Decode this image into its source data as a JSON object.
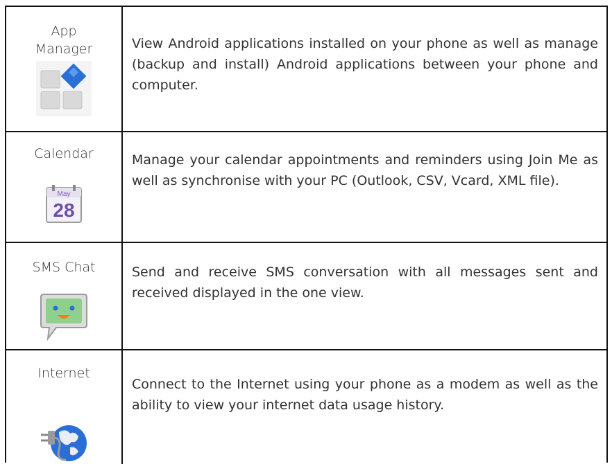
{
  "rows": [
    {
      "name": "App\nManager",
      "icon": "app-manager-icon",
      "description": "View Android applications installed on your phone as well as manage (backup and install) Android applications between your phone and computer."
    },
    {
      "name": "Calendar",
      "icon": "calendar-icon",
      "icon_month": "May",
      "icon_day": "28",
      "description": "Manage your calendar appointments and reminders using Join Me as well as synchronise with your PC (Outlook, CSV, Vcard, XML file)."
    },
    {
      "name": "SMS Chat",
      "icon": "sms-chat-icon",
      "description": "Send and receive SMS conversation with all messages sent and received displayed in the one view."
    },
    {
      "name": "Internet",
      "icon": "internet-icon",
      "description": "Connect to the Internet using your phone as a modem as well as the ability to view your internet data usage history."
    }
  ],
  "colors": {
    "border": "#111111",
    "text": "#333333",
    "accent_blue": "#2a6fd6",
    "calendar_purple": "#7b5fb8"
  }
}
